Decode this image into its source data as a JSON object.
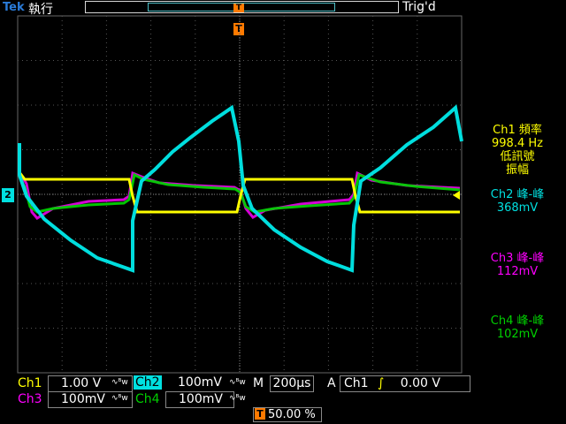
{
  "header": {
    "brand": "Tek",
    "run_state": "執行",
    "trigger_state": "Trig'd",
    "trigger_marker": "T"
  },
  "measurements": {
    "ch1": {
      "label": "Ch1 頻率",
      "value": "998.4 Hz",
      "note1": "低訊號",
      "note2": "振幅"
    },
    "ch2": {
      "label": "Ch2 峰-峰",
      "value": "368mV"
    },
    "ch3": {
      "label": "Ch3 峰-峰",
      "value": "112mV"
    },
    "ch4": {
      "label": "Ch4 峰-峰",
      "value": "102mV"
    }
  },
  "channel_marker": "2",
  "status_bar": {
    "ch1": {
      "label": "Ch1",
      "scale": "1.00 V"
    },
    "ch2": {
      "label": "Ch2",
      "scale": "100mV"
    },
    "ch3": {
      "label": "Ch3",
      "scale": "100mV"
    },
    "ch4": {
      "label": "Ch4",
      "scale": "100mV"
    },
    "bw_symbol": "∿ᴮw",
    "timebase": {
      "label": "M",
      "value": "200µs"
    },
    "trigger": {
      "mode": "A",
      "source": "Ch1",
      "slope": "∫",
      "level": "0.00 V"
    },
    "trigger_position": {
      "icon": "T",
      "value": "50.00 %"
    }
  },
  "colors": {
    "ch1": "#ffff00",
    "ch2": "#00e0e0",
    "ch3": "#ff00ff",
    "ch4": "#00d000",
    "trigger": "#ff7a00"
  }
}
